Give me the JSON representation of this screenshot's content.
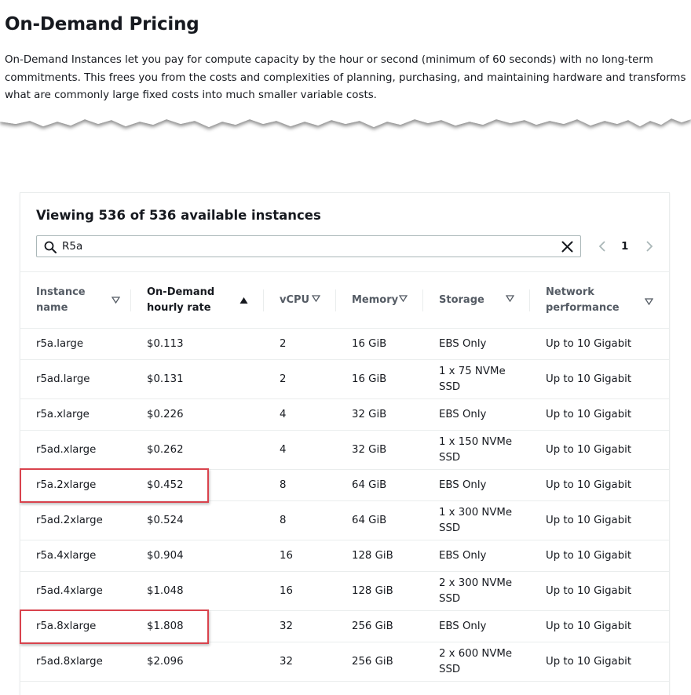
{
  "page": {
    "title": "On-Demand Pricing",
    "intro": "On-Demand Instances let you pay for compute capacity by the hour or second (minimum of 60 seconds) with no long-term commitments. This frees you from the costs and complexities of planning, purchasing, and maintaining hardware and transforms what are commonly large fixed costs into much smaller variable costs."
  },
  "table_card": {
    "title": "Viewing 536 of 536 available instances",
    "search": {
      "value": "R5a",
      "icon": "search-icon",
      "clear_icon": "close-icon"
    },
    "pagination": {
      "current_page": "1",
      "prev_icon": "chevron-left-icon",
      "next_icon": "chevron-right-icon"
    },
    "columns": [
      {
        "label": "Instance name",
        "sort": "none"
      },
      {
        "label": "On-Demand hourly rate",
        "sort": "ascending"
      },
      {
        "label": "vCPU",
        "sort": "none"
      },
      {
        "label": "Memory",
        "sort": "none"
      },
      {
        "label": "Storage",
        "sort": "none"
      },
      {
        "label": "Network performance",
        "sort": "none"
      }
    ],
    "rows": [
      {
        "name": "r5a.large",
        "rate": "$0.113",
        "vcpu": "2",
        "memory": "16 GiB",
        "storage": "EBS Only",
        "network": "Up to 10 Gigabit"
      },
      {
        "name": "r5ad.large",
        "rate": "$0.131",
        "vcpu": "2",
        "memory": "16 GiB",
        "storage": "1 x 75 NVMe SSD",
        "network": "Up to 10 Gigabit"
      },
      {
        "name": "r5a.xlarge",
        "rate": "$0.226",
        "vcpu": "4",
        "memory": "32 GiB",
        "storage": "EBS Only",
        "network": "Up to 10 Gigabit"
      },
      {
        "name": "r5ad.xlarge",
        "rate": "$0.262",
        "vcpu": "4",
        "memory": "32 GiB",
        "storage": "1 x 150 NVMe SSD",
        "network": "Up to 10 Gigabit"
      },
      {
        "name": "r5a.2xlarge",
        "rate": "$0.452",
        "vcpu": "8",
        "memory": "64 GiB",
        "storage": "EBS Only",
        "network": "Up to 10 Gigabit"
      },
      {
        "name": "r5ad.2xlarge",
        "rate": "$0.524",
        "vcpu": "8",
        "memory": "64 GiB",
        "storage": "1 x 300 NVMe SSD",
        "network": "Up to 10 Gigabit"
      },
      {
        "name": "r5a.4xlarge",
        "rate": "$0.904",
        "vcpu": "16",
        "memory": "128 GiB",
        "storage": "EBS Only",
        "network": "Up to 10 Gigabit"
      },
      {
        "name": "r5ad.4xlarge",
        "rate": "$1.048",
        "vcpu": "16",
        "memory": "128 GiB",
        "storage": "2 x 300 NVMe SSD",
        "network": "Up to 10 Gigabit"
      },
      {
        "name": "r5a.8xlarge",
        "rate": "$1.808",
        "vcpu": "32",
        "memory": "256 GiB",
        "storage": "EBS Only",
        "network": "Up to 10 Gigabit"
      },
      {
        "name": "r5ad.8xlarge",
        "rate": "$2.096",
        "vcpu": "32",
        "memory": "256 GiB",
        "storage": "2 x 600 NVMe SSD",
        "network": "Up to 10 Gigabit"
      }
    ],
    "highlighted_rows": [
      "r5a.2xlarge",
      "r5a.8xlarge"
    ]
  },
  "colors": {
    "text": "#16191f",
    "header_text": "#545b64",
    "border": "#eaeded",
    "highlight_box": "#d9434d"
  }
}
